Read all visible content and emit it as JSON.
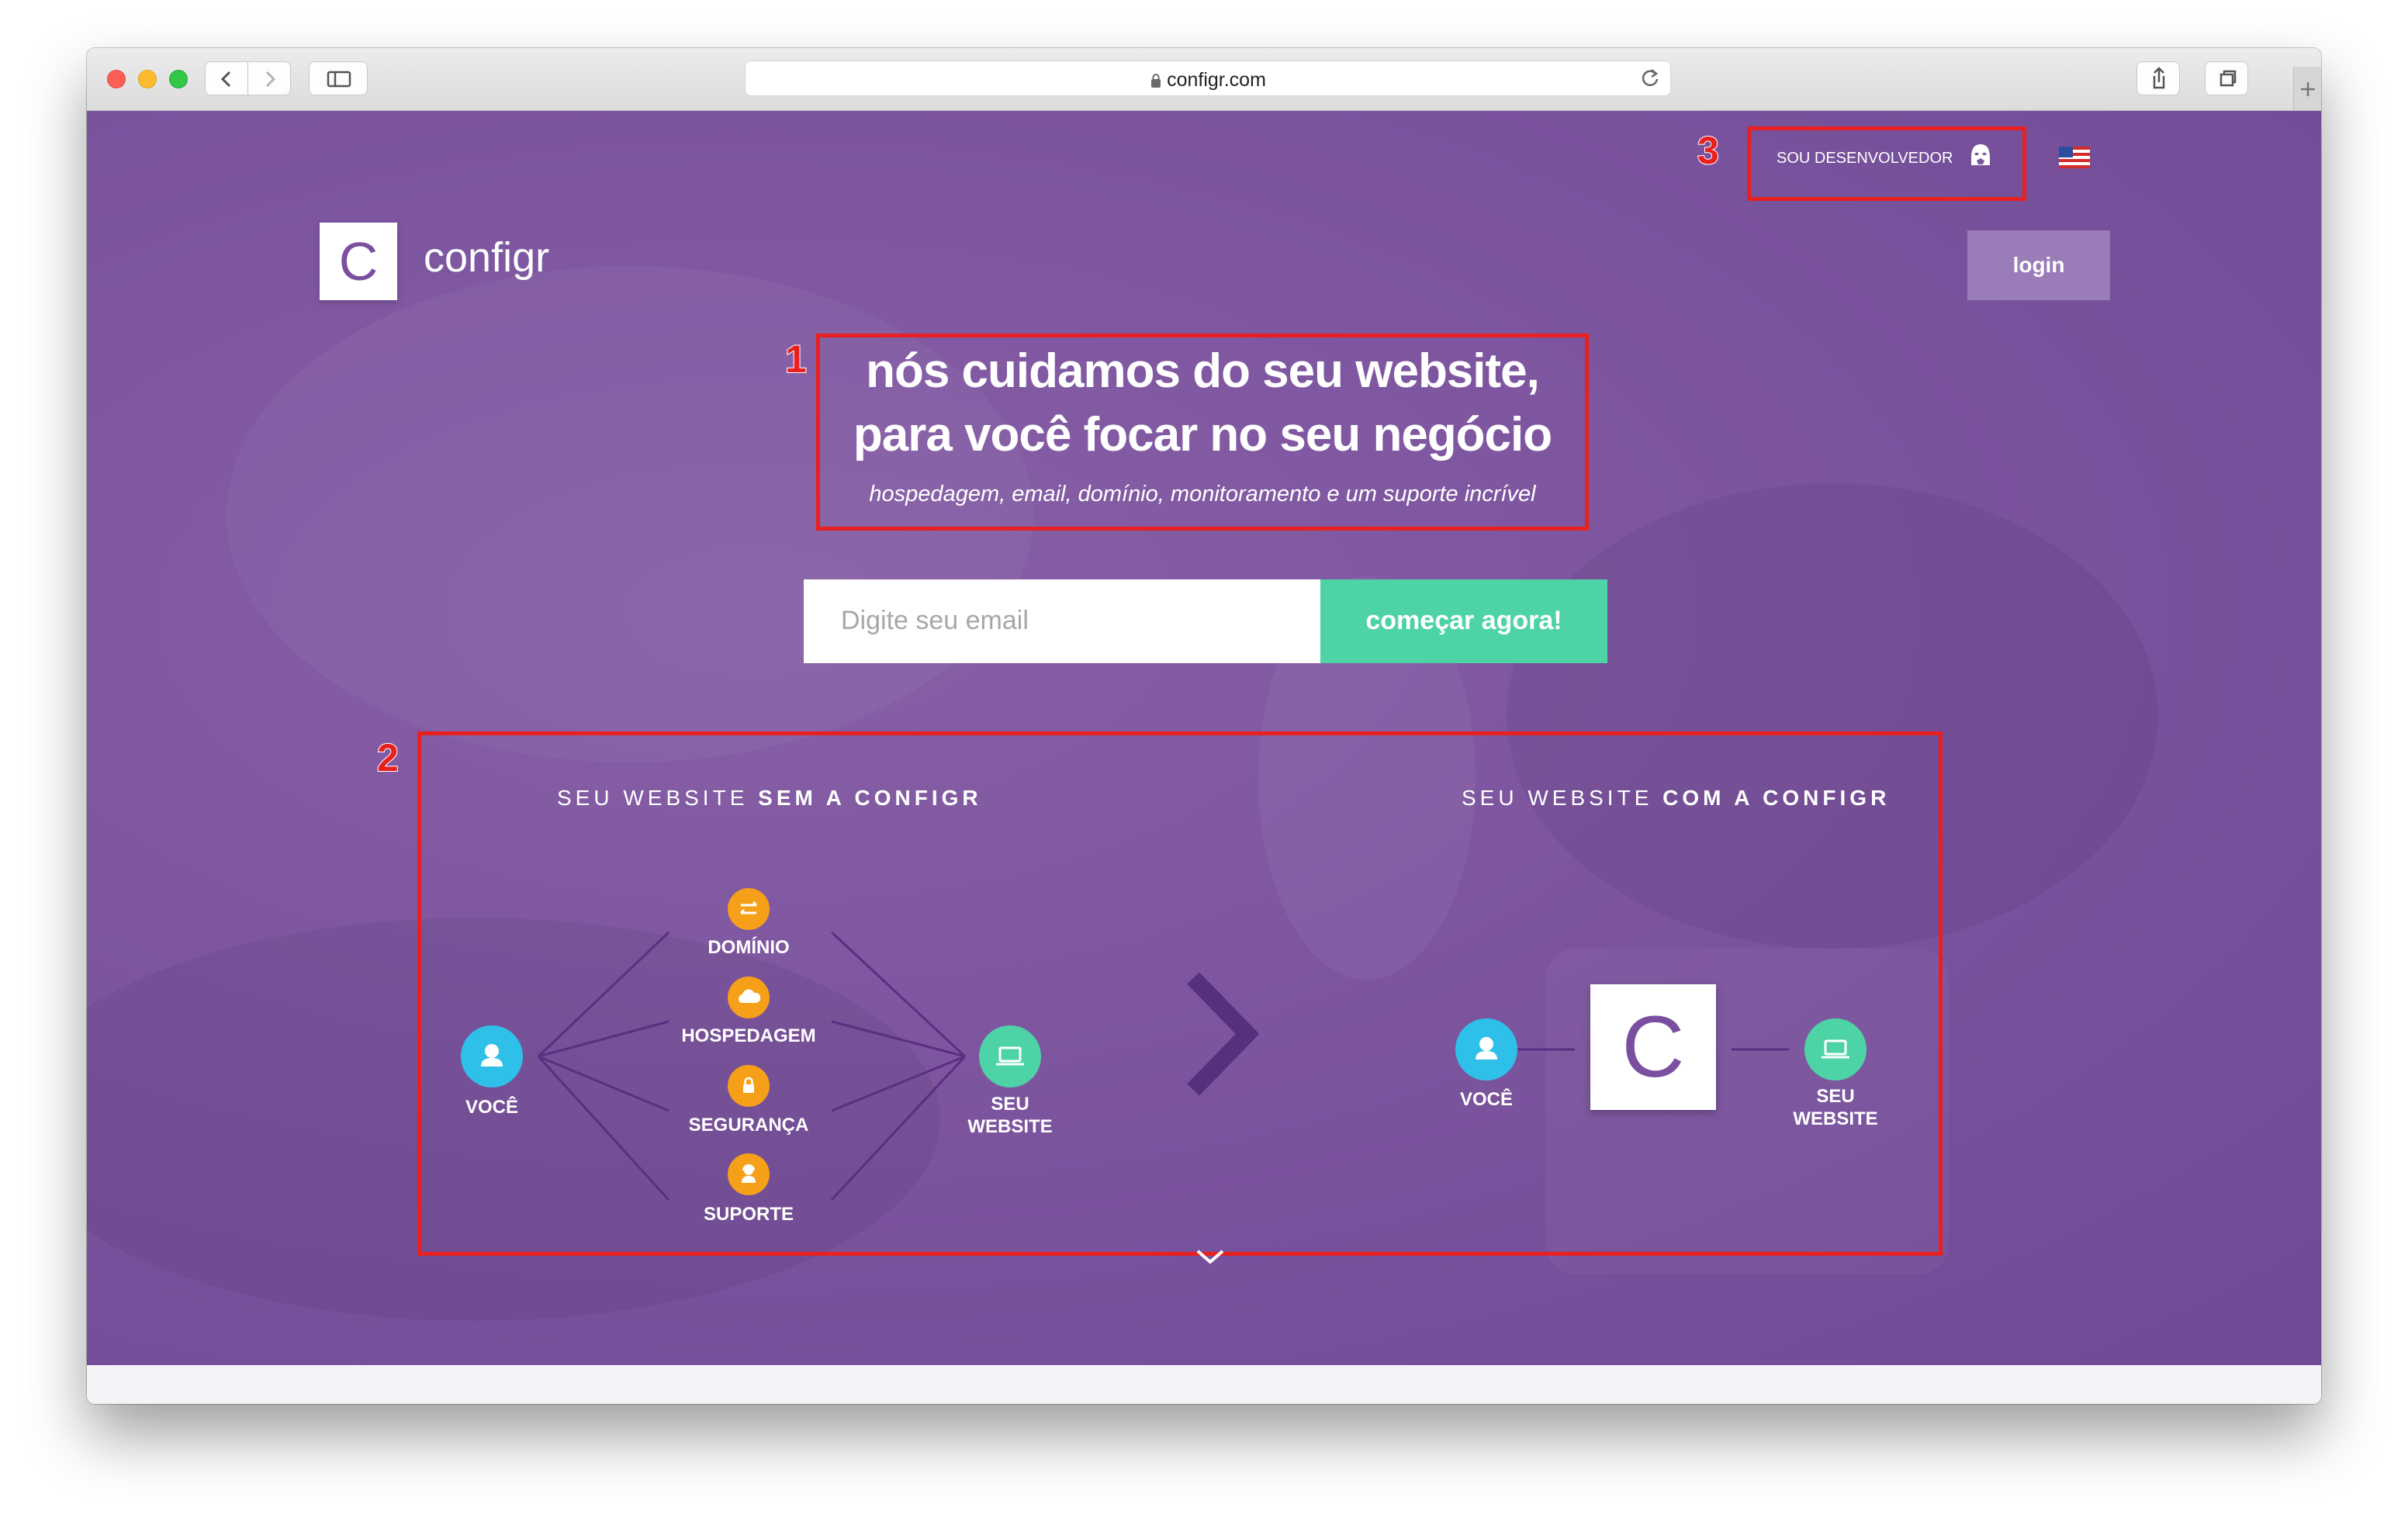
{
  "browser": {
    "url": "configr.com",
    "colors": {
      "close": "#fc5f57",
      "minimize": "#fdbc2e",
      "maximize": "#33c748"
    }
  },
  "header": {
    "dev_label": "SOU DESENVOLVEDOR",
    "dev_icon": "stormtrooper-helmet-icon",
    "flag_icon": "us-flag-icon",
    "logo_letter": "C",
    "logo_text": "configr",
    "login_label": "login"
  },
  "hero": {
    "title_line1": "nós cuidamos do seu website,",
    "title_line2": "para você focar no seu negócio",
    "subtitle": "hospedagem, email, domínio, monitoramento e um suporte incrível",
    "email_placeholder": "Digite seu email",
    "cta_label": "começar agora!"
  },
  "comparison": {
    "without": {
      "title_prefix": "SEU WEBSITE ",
      "title_bold": "SEM A CONFIGR",
      "you": "VOCÊ",
      "website_line1": "SEU",
      "website_line2": "WEBSITE",
      "services": [
        "DOMÍNIO",
        "HOSPEDAGEM",
        "SEGURANÇA",
        "SUPORTE"
      ]
    },
    "with": {
      "title_prefix": "SEU WEBSITE ",
      "title_bold": "COM A CONFIGR",
      "you": "VOCÊ",
      "logo_letter": "C",
      "website_line1": "SEU",
      "website_line2": "WEBSITE"
    }
  },
  "annotations": {
    "box1": "1",
    "box2": "2",
    "box3": "3"
  },
  "colors": {
    "hero_bg": "#7e56a0",
    "brand_purple": "#7b4fa0",
    "accent_green": "#4dd3a6",
    "node_blue": "#2fc0ea",
    "node_orange": "#f6a01a",
    "annotation_red": "#e8201f"
  }
}
